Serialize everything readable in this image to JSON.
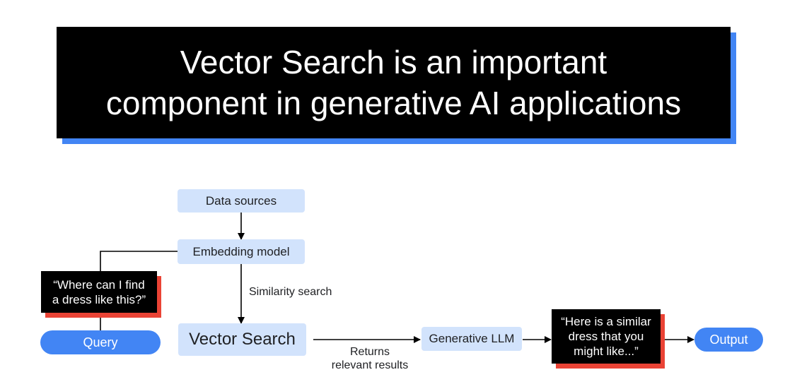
{
  "title": {
    "line1": "Vector Search is an important",
    "line2": "component in generative AI applications"
  },
  "diagram": {
    "data_sources": "Data sources",
    "embedding_model": "Embedding model",
    "similarity_search": "Similarity search",
    "vector_search": "Vector Search",
    "query_quote": {
      "line1": "“Where can I find",
      "line2": "a dress like this?”"
    },
    "query": "Query",
    "returns": {
      "line1": "Returns",
      "line2": "relevant results"
    },
    "generative_llm": "Generative LLM",
    "answer_quote": {
      "line1": "“Here is a similar",
      "line2": "dress that you",
      "line3": "might like...”"
    },
    "output": "Output"
  },
  "colors": {
    "accent_blue": "#4285f4",
    "node_fill": "#d2e3fc",
    "quote_shadow_red": "#ea4335"
  }
}
